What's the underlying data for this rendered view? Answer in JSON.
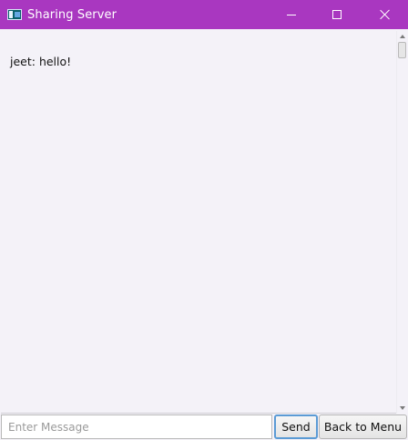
{
  "window": {
    "title": "Sharing Server",
    "accent_color": "#a937c0"
  },
  "chat": {
    "messages": [
      {
        "text": "jeet: hello!"
      }
    ]
  },
  "composer": {
    "placeholder": "Enter Message",
    "value": "",
    "send_label": "Send",
    "back_label": "Back to Menu"
  }
}
